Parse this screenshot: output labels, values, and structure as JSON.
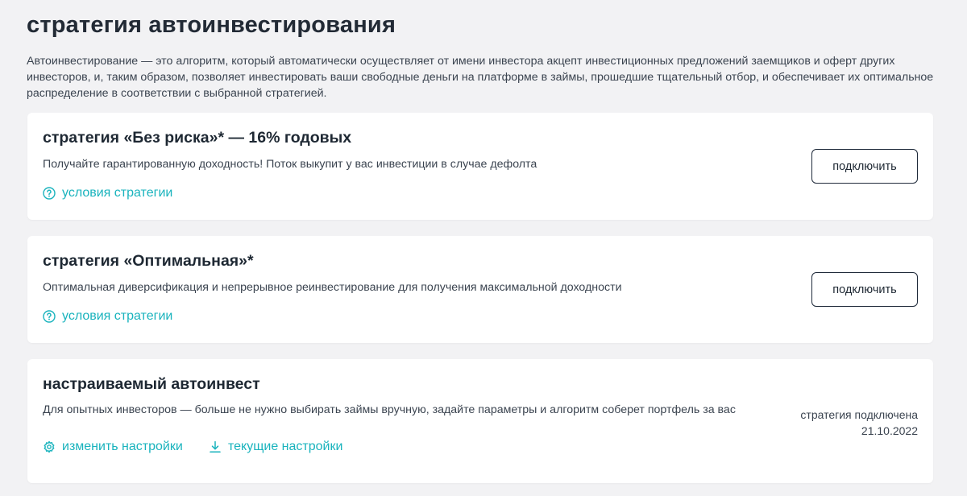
{
  "page": {
    "title": "стратегия автоинвестирования",
    "intro": "Автоинвестирование — это алгоритм, который автоматически осуществляет от имени инвестора акцепт инвестиционных предложений заемщиков и оферт других инвесторов, и, таким образом, позволяет инвестировать ваши свободные деньги на платформе в займы, прошедшие тщательный отбор, и обеспечивает их оптимальное распределение в соответствии с выбранной стратегией."
  },
  "strategies": [
    {
      "title": "стратегия «Без риска»* — 16% годовых",
      "description": "Получайте гарантированную доходность! Поток выкупит у вас инвестиции в случае дефолта",
      "terms_link": "условия стратегии",
      "terms_icon": "question-circle-icon",
      "button_label": "подключить"
    },
    {
      "title": "стратегия «Оптимальная»*",
      "description": "Оптимальная диверсификация и непрерывное реинвестирование для получения максимальной доходности",
      "terms_link": "условия стратегии",
      "terms_icon": "question-circle-icon",
      "button_label": "подключить"
    }
  ],
  "custom": {
    "title": "настраиваемый автоинвест",
    "description": "Для опытных инвесторов — больше не нужно выбирать займы вручную, задайте параметры и алгоритм соберет портфель за вас",
    "change_settings": "изменить настройки",
    "change_settings_icon": "gear-icon",
    "current_settings": "текущие настройки",
    "current_settings_icon": "download-icon",
    "status_label": "стратегия подключена",
    "status_date": "21.10.2022"
  },
  "colors": {
    "background": "#f2f2f4",
    "card": "#ffffff",
    "accent": "#19b3bd",
    "text": "#1e2833",
    "button_border": "#1f2a3a"
  }
}
